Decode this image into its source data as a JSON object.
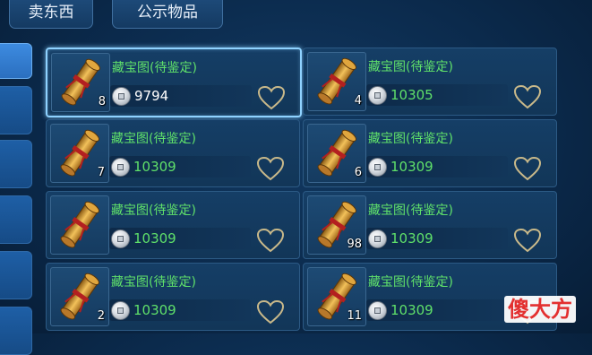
{
  "tabs": [
    {
      "label": "卖东西"
    },
    {
      "label": "公示物品"
    }
  ],
  "items": [
    {
      "name": "藏宝图(待鉴定)",
      "count": "8",
      "price": "9794",
      "selected": true
    },
    {
      "name": "藏宝图(待鉴定)",
      "count": "4",
      "price": "10305",
      "selected": false
    },
    {
      "name": "藏宝图(待鉴定)",
      "count": "7",
      "price": "10309",
      "selected": false
    },
    {
      "name": "藏宝图(待鉴定)",
      "count": "6",
      "price": "10309",
      "selected": false
    },
    {
      "name": "藏宝图(待鉴定)",
      "count": "",
      "price": "10309",
      "selected": false
    },
    {
      "name": "藏宝图(待鉴定)",
      "count": "98",
      "price": "10309",
      "selected": false
    },
    {
      "name": "藏宝图(待鉴定)",
      "count": "2",
      "price": "10309",
      "selected": false
    },
    {
      "name": "藏宝图(待鉴定)",
      "count": "11",
      "price": "10309",
      "selected": false
    }
  ],
  "icons": {
    "item": "scroll-icon",
    "currency": "silver-coin-icon",
    "favorite": "heart-icon"
  },
  "colors": {
    "name_green": "#5fe06a",
    "selected_border": "#8fd2ff"
  },
  "watermark": {
    "text": "傻大方"
  }
}
